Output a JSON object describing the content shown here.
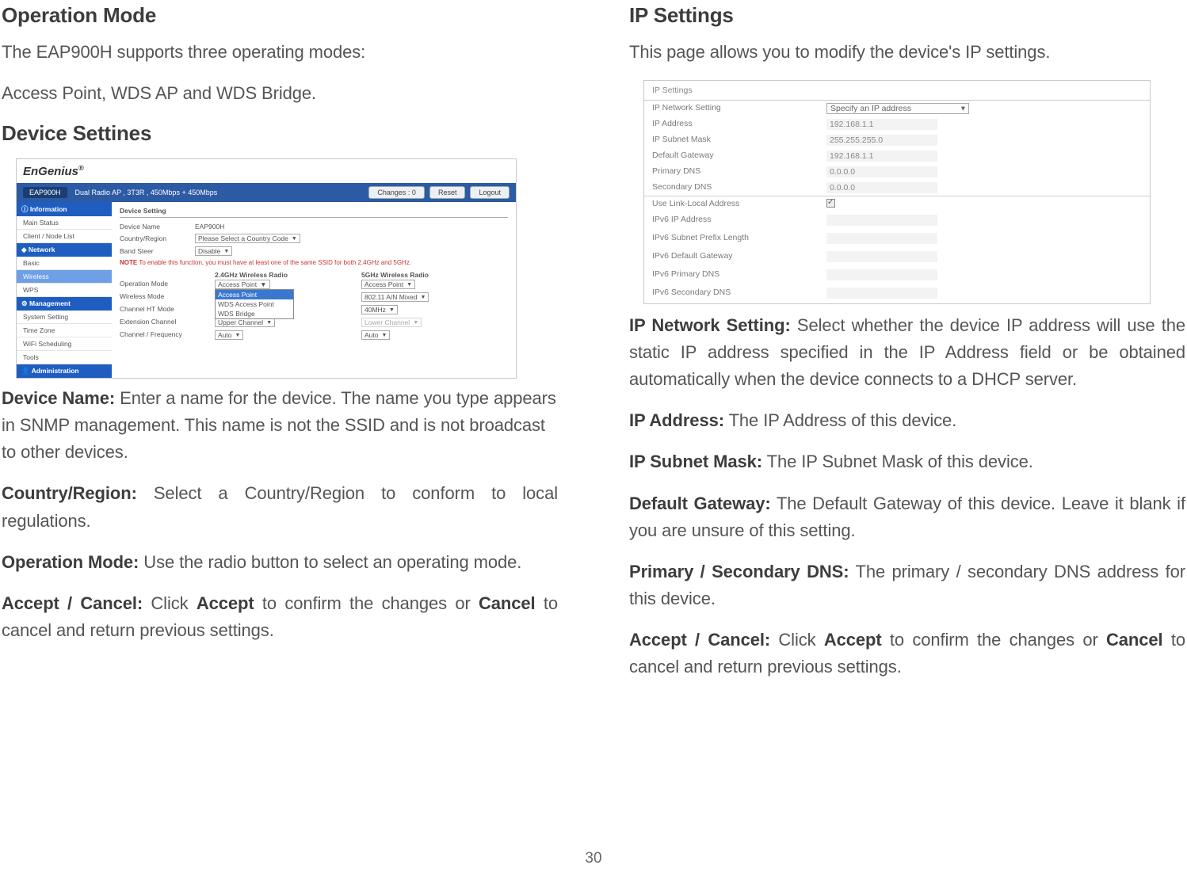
{
  "pageNumber": "30",
  "left": {
    "h_operationMode": "Operation Mode",
    "p_modesIntro": "The EAP900H supports three operating modes:",
    "p_modesList": "Access Point, WDS AP and WDS Bridge.",
    "h_deviceSettings": "Device Settines",
    "deviceName": {
      "label": "Device Name:",
      "text": " Enter a name for the device. The name you type appears in SNMP management. This name is not the SSID and is not broadcast to other devices."
    },
    "countryRegion": {
      "label": "Country/Region:",
      "text": " Select a Country/Region to conform to local regulations."
    },
    "operationMode": {
      "label": "Operation Mode:",
      "text": " Use the radio button to select an operating mode."
    },
    "acceptCancel": {
      "label": "Accept / Cancel:",
      "text1": " Click ",
      "accept": "Accept",
      "text2": " to confirm the changes or ",
      "cancel": "Cancel",
      "text3": " to cancel and return previous settings."
    }
  },
  "right": {
    "h_ipSettings": "IP Settings",
    "p_intro": "This page allows you to modify the device's IP settings.",
    "ipNetwork": {
      "label": "IP Network Setting:",
      "text": " Select whether the device IP address will use the static IP address specified in the IP Address field or be obtained automatically when the device connects to a DHCP server."
    },
    "ipAddress": {
      "label": "IP Address:",
      "text": " The IP Address of this device."
    },
    "ipSubnet": {
      "label": "IP Subnet Mask:",
      "text": " The IP Subnet Mask of this device."
    },
    "defaultGw": {
      "label": "Default Gateway:",
      "text": " The Default Gateway of this device. Leave it blank if you are unsure of this setting."
    },
    "dns": {
      "label": "Primary / Secondary DNS:",
      "text": " The primary / secondary DNS address for this device."
    },
    "acceptCancel": {
      "label": "Accept / Cancel:",
      "text1": " Click ",
      "accept": "Accept",
      "text2": " to confirm the changes or ",
      "cancel": "Cancel",
      "text3": " to cancel and return previous settings."
    }
  },
  "ss1": {
    "logo": "EnGenius",
    "model": "EAP900H",
    "desc": "Dual Radio AP , 3T3R , 450Mbps + 450Mbps",
    "btnChanges": "Changes : 0",
    "btnReset": "Reset",
    "btnLogout": "Logout",
    "side": {
      "catInfo": "Information",
      "mainStatus": "Main Status",
      "clientNode": "Client / Node List",
      "catNetwork": "Network",
      "basic": "Basic",
      "wireless": "Wireless",
      "wps": "WPS",
      "catMgmt": "Management",
      "sysSetting": "System Setting",
      "timeZone": "Time Zone",
      "wifiSched": "WiFi Scheduling",
      "tools": "Tools",
      "catAdmin": "Administration"
    },
    "panel": {
      "title": "Device Setting",
      "dnLabel": "Device Name",
      "dnVal": "EAP900H",
      "crLabel": "Country/Region",
      "crVal": "Please Select a Country Code",
      "bsLabel": "Band Steer",
      "bsVal": "Disable",
      "noteLabel": "NOTE",
      "noteText": " To enable this function, you must have at least one of the same SSID for both 2.4GHz and 5GHz.",
      "col24": "2.4GHz Wireless Radio",
      "col5": "5GHz Wireless Radio",
      "rows": {
        "opMode": "Operation Mode",
        "wMode": "Wireless Mode",
        "htMode": "Channel HT Mode",
        "extCh": "Extension Channel",
        "chFreq": "Channel / Frequency"
      },
      "drop": {
        "ap": "Access Point",
        "wdsap": "WDS Access Point",
        "wdsbr": "WDS Bridge"
      },
      "c5": {
        "op": "Access Point",
        "wm": "802.11 A/N Mixed",
        "ht": "40MHz",
        "ext": "Lower Channel",
        "ch": "Auto"
      },
      "c24": {
        "ht": "Upper Channel",
        "ch": "Auto"
      }
    }
  },
  "ss2": {
    "title": "IP Settings",
    "rows": {
      "ipNet": {
        "k": "IP Network Setting",
        "v": "Specify an IP address"
      },
      "ipAddr": {
        "k": "IP Address",
        "v": "192.168.1.1"
      },
      "subnet": {
        "k": "IP Subnet Mask",
        "v": "255.255.255.0"
      },
      "gw": {
        "k": "Default Gateway",
        "v": "192.168.1.1"
      },
      "pdns": {
        "k": "Primary DNS",
        "v": "0.0.0.0"
      },
      "sdns": {
        "k": "Secondary DNS",
        "v": "0.0.0.0"
      },
      "linklocal": {
        "k": "Use Link-Local Address"
      },
      "ip6addr": {
        "k": "IPv6 IP Address"
      },
      "ip6prefix": {
        "k": "IPv6 Subnet Prefix Length"
      },
      "ip6gw": {
        "k": "IPv6 Default Gateway"
      },
      "ip6pdns": {
        "k": "IPv6 Primary DNS"
      },
      "ip6sdns": {
        "k": "IPv6 Secondary DNS"
      }
    }
  }
}
